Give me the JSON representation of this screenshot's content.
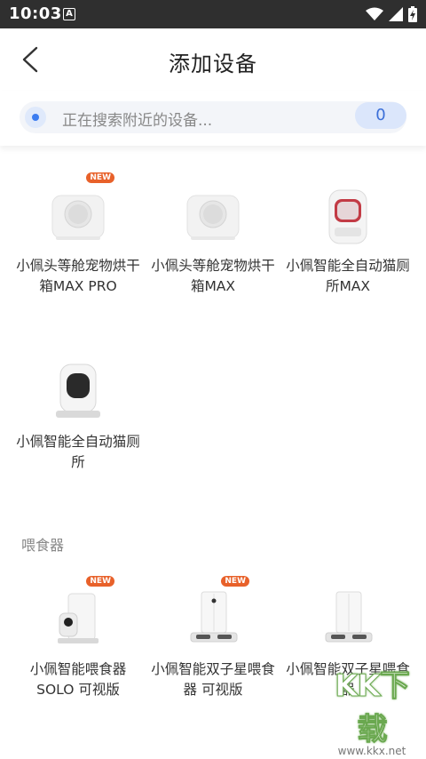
{
  "status_bar": {
    "time": "10:03",
    "badge": "A"
  },
  "nav": {
    "title": "添加设备"
  },
  "search": {
    "text": "正在搜索附近的设备...",
    "count": "0"
  },
  "cut_heading": "",
  "sections": [
    {
      "title": "",
      "items": [
        {
          "label": "小佩头等舱宠物烘干箱MAX PRO",
          "new": true,
          "icon": "pet-dryer-icon"
        },
        {
          "label": "小佩头等舱宠物烘干箱MAX",
          "new": false,
          "icon": "pet-dryer-icon"
        },
        {
          "label": "小佩智能全自动猫厕所MAX",
          "new": false,
          "icon": "litter-box-max-icon"
        },
        {
          "label": "小佩智能全自动猫厕所",
          "new": false,
          "icon": "litter-box-icon"
        }
      ]
    },
    {
      "title": "喂食器",
      "items": [
        {
          "label": "小佩智能喂食器 SOLO 可视版",
          "new": true,
          "icon": "feeder-camera-icon"
        },
        {
          "label": "小佩智能双子星喂食器 可视版",
          "new": true,
          "icon": "twin-feeder-camera-icon"
        },
        {
          "label": "小佩智能双子星喂食器",
          "new": false,
          "icon": "twin-feeder-icon"
        }
      ]
    }
  ],
  "new_badge_label": "NEW",
  "watermark": {
    "big": "KK下载",
    "url": "www.kkx.net"
  }
}
